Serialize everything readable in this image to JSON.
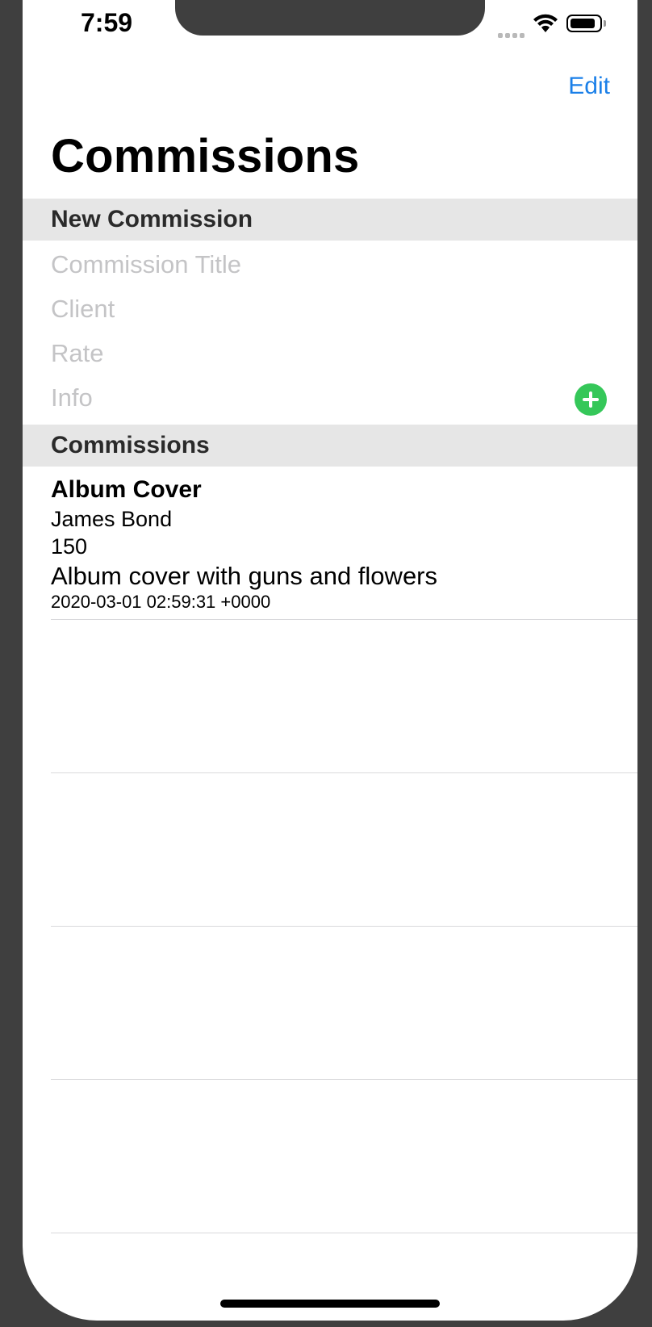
{
  "status_bar": {
    "time": "7:59"
  },
  "nav": {
    "edit_label": "Edit",
    "large_title": "Commissions"
  },
  "new_section": {
    "header": "New Commission",
    "fields": {
      "title_placeholder": "Commission Title",
      "client_placeholder": "Client",
      "rate_placeholder": "Rate",
      "info_placeholder": "Info"
    },
    "add_icon": "plus-circle-icon",
    "add_color": "#35c759"
  },
  "list_section": {
    "header": "Commissions",
    "items": [
      {
        "title": "Album Cover",
        "client": "James Bond",
        "rate": "150",
        "info": "Album cover with guns and flowers",
        "date": "2020-03-01 02:59:31 +0000"
      }
    ]
  },
  "colors": {
    "accent": "#1a7fe8",
    "section_header_bg": "#e6e6e6",
    "bezel": "#3f3f3f"
  }
}
